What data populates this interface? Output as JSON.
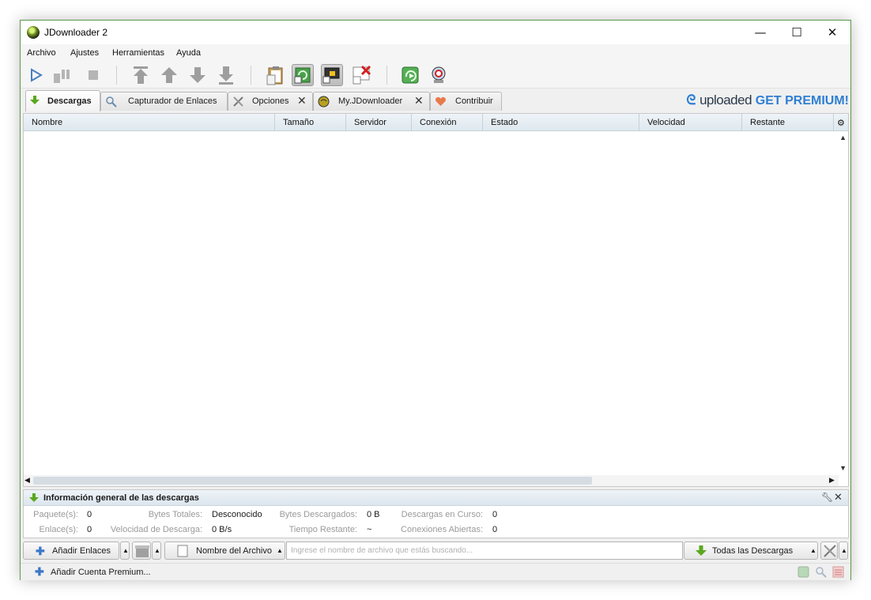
{
  "window": {
    "title": "JDownloader 2"
  },
  "controls": {
    "minimize": "—",
    "maximize": "☐",
    "close": "✕"
  },
  "menu": [
    "Archivo",
    "Ajustes",
    "Herramientas",
    "Ayuda"
  ],
  "toolbar": {
    "icons": [
      "play-icon",
      "pause-icon",
      "stop-icon",
      "move-top-icon",
      "move-up-icon",
      "move-down-icon",
      "move-bottom-icon",
      "clipboard-icon",
      "auto-reconnect-icon",
      "premium-lock-icon",
      "remove-icon",
      "reconnect-icon",
      "update-icon"
    ],
    "active": [
      "auto-reconnect-icon",
      "premium-lock-icon"
    ]
  },
  "tabs": [
    {
      "label": "Descargas",
      "icon": "download-arrow-icon",
      "active": true,
      "closable": false
    },
    {
      "label": "Capturador de Enlaces",
      "icon": "linkgrabber-icon",
      "active": false,
      "closable": false
    },
    {
      "label": "Opciones",
      "icon": "settings-tools-icon",
      "active": false,
      "closable": true
    },
    {
      "label": "My.JDownloader",
      "icon": "myjd-logo-icon",
      "active": false,
      "closable": true
    },
    {
      "label": "Contribuir",
      "icon": "heart-icon",
      "active": false,
      "closable": false
    }
  ],
  "promo": {
    "brand": "uploaded",
    "cta": "GET PREMIUM!"
  },
  "table": {
    "columns": [
      "Nombre",
      "Tamaño",
      "Servidor",
      "Conexión",
      "Estado",
      "Velocidad",
      "Restante"
    ],
    "rows": []
  },
  "overview": {
    "title": "Información general de las descargas",
    "row1": [
      {
        "label": "Paquete(s):",
        "value": "0"
      },
      {
        "label": "Bytes Totales:",
        "value": "Desconocido"
      },
      {
        "label": "Bytes Descargados:",
        "value": "0 B"
      },
      {
        "label": "Descargas en Curso:",
        "value": "0"
      }
    ],
    "row2": [
      {
        "label": "Enlace(s):",
        "value": "0"
      },
      {
        "label": "Velocidad de Descarga:",
        "value": "0 B/s"
      },
      {
        "label": "Tiempo Restante:",
        "value": "~"
      },
      {
        "label": "Conexiones Abiertas:",
        "value": "0"
      }
    ]
  },
  "bottom": {
    "add_links": "Añadir Enlaces",
    "search_mode": "Nombre del Archivo",
    "search_placeholder": "Ingrese el nombre de archivo que estás buscando...",
    "filter": "Todas las Descargas"
  },
  "status": {
    "add_premium": "Añadir Cuenta Premium..."
  },
  "colors": {
    "accent": "#2e7fd3",
    "green": "#5aa81e",
    "header_bg": "#e4ecf2"
  }
}
